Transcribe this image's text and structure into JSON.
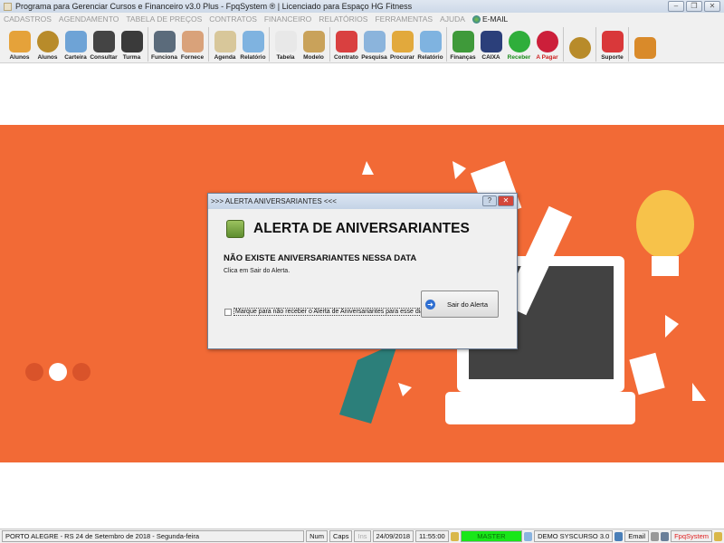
{
  "window": {
    "title": "Programa para Gerenciar Cursos e Financeiro v3.0 Plus - FpqSystem ® | Licenciado para  Espaço HG Fitness",
    "minimize": "–",
    "restore": "❐",
    "close": "✕"
  },
  "menu": [
    "CADASTROS",
    "AGENDAMENTO",
    "TABELA DE PREÇOS",
    "CONTRATOS",
    "FINANCEIRO",
    "RELATÓRIOS",
    "FERRAMENTAS",
    "AJUDA"
  ],
  "menu_email": "E-MAIL",
  "toolbar": [
    {
      "label": "Alunos",
      "icon": "students-icon",
      "color": "#e5a23a"
    },
    {
      "label": "Alunos",
      "icon": "coin-icon",
      "color": "#b88b2a"
    },
    {
      "label": "Carteira",
      "icon": "id-card-icon",
      "color": "#6ea3d6"
    },
    {
      "label": "Consultar",
      "icon": "id-badge-icon",
      "color": "#444444"
    },
    {
      "label": "Turma",
      "icon": "monitor-icon",
      "color": "#3a3a3a"
    },
    {
      "label": "Funciona",
      "icon": "employees-icon",
      "color": "#5b6b7b"
    },
    {
      "label": "Fornece",
      "icon": "supplier-icon",
      "color": "#d9a27a"
    },
    {
      "label": "Agenda",
      "icon": "calendar-icon",
      "color": "#d8c79a"
    },
    {
      "label": "Relatório",
      "icon": "printer-icon",
      "color": "#7fb3e0"
    },
    {
      "label": "Tabela",
      "icon": "table-doc-icon",
      "color": "#e8e8e8"
    },
    {
      "label": "Modelo",
      "icon": "parchment-icon",
      "color": "#c9a25a"
    },
    {
      "label": "Contrato",
      "icon": "pen-icon",
      "color": "#d94040"
    },
    {
      "label": "Pesquisa",
      "icon": "search-doc-icon",
      "color": "#8bb4dc"
    },
    {
      "label": "Procurar",
      "icon": "folder-icon",
      "color": "#e2a93c"
    },
    {
      "label": "Relatório",
      "icon": "printer-icon",
      "color": "#7fb3e0"
    },
    {
      "label": "Finanças",
      "icon": "finance-chart-icon",
      "color": "#3f9a3a"
    },
    {
      "label": "CAIXA",
      "icon": "cashbook-icon",
      "color": "#2b3f7a"
    },
    {
      "label": "Receber",
      "icon": "dollar-green-icon",
      "color": "#2fae3b"
    },
    {
      "label": "A Pagar",
      "icon": "dollar-red-icon",
      "color": "#cc1f3a"
    },
    {
      "label": "",
      "icon": "coin-icon",
      "color": "#b88b2a"
    },
    {
      "label": "Suporte",
      "icon": "support-icon",
      "color": "#d9383a"
    },
    {
      "label": "",
      "icon": "exit-door-icon",
      "color": "#d98a2a"
    }
  ],
  "dialog": {
    "title": ">>> ALERTA ANIVERSARIANTES <<<",
    "help": "?",
    "close": "✕",
    "heading": "ALERTA DE ANIVERSARIANTES",
    "message": "NÃO EXISTE ANIVERSARIANTES NESSA DATA",
    "sub": "Clica em Sair do Alerta.",
    "checkbox_label": "Marque para não receber o Alerta de Aniversariantes para esse dia",
    "checkbox_checked": false,
    "exit_button": "Sair do Alerta",
    "exit_icon": "➜"
  },
  "status": {
    "location": "PORTO ALEGRE - RS 24 de Setembro de 2018 - Segunda-feira",
    "num": "Num",
    "caps": "Caps",
    "ins": "Ins",
    "date": "24/09/2018",
    "time": "11:55:00",
    "user": "MASTER",
    "version": "DEMO SYSCURSO 3.0",
    "email": "Email",
    "brand": "FpqSystem",
    "user_color": "#19e619",
    "brand_color": "#e02020"
  },
  "colors": {
    "banner": "#f26a36"
  }
}
